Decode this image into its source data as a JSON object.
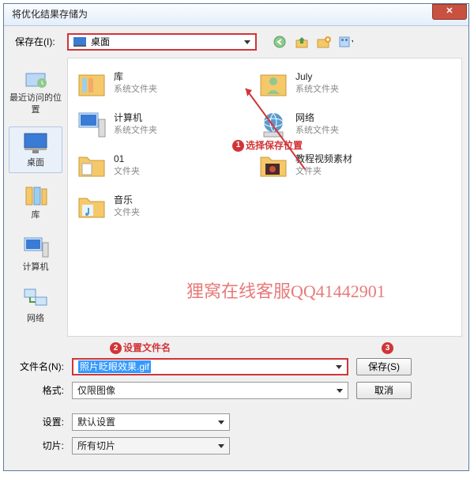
{
  "title": "将优化结果存储为",
  "saveIn": {
    "label": "保存在(I):",
    "value": "桌面"
  },
  "toolbarIcons": [
    "back-icon",
    "up-icon",
    "new-folder-icon",
    "view-icon"
  ],
  "sidebar": [
    {
      "label": "最近访问的位置",
      "icon": "recent"
    },
    {
      "label": "桌面",
      "icon": "desktop",
      "selected": true
    },
    {
      "label": "库",
      "icon": "libraries"
    },
    {
      "label": "计算机",
      "icon": "computer"
    },
    {
      "label": "网络",
      "icon": "network"
    }
  ],
  "folders": [
    {
      "name": "库",
      "sub": "系统文件夹",
      "icon": "lib"
    },
    {
      "name": "July",
      "sub": "系统文件夹",
      "icon": "user"
    },
    {
      "name": "计算机",
      "sub": "系统文件夹",
      "icon": "pc"
    },
    {
      "name": "网络",
      "sub": "系统文件夹",
      "icon": "net"
    },
    {
      "name": "01",
      "sub": "文件夹",
      "icon": "folder"
    },
    {
      "name": "教程视频素材",
      "sub": "文件夹",
      "icon": "folder2"
    },
    {
      "name": "音乐",
      "sub": "文件夹",
      "icon": "music"
    }
  ],
  "annotations": {
    "a1": "选择保存位置",
    "a2": "设置文件名",
    "a3": ""
  },
  "watermark": "狸窝在线客服QQ41442901",
  "filename": {
    "label": "文件名(N):",
    "value": "照片眨眼效果.gif"
  },
  "format": {
    "label": "格式:",
    "value": "仅限图像"
  },
  "settings": {
    "label": "设置:",
    "value": "默认设置"
  },
  "slice": {
    "label": "切片:",
    "value": "所有切片"
  },
  "saveBtn": "保存(S)",
  "cancelBtn": "取消"
}
